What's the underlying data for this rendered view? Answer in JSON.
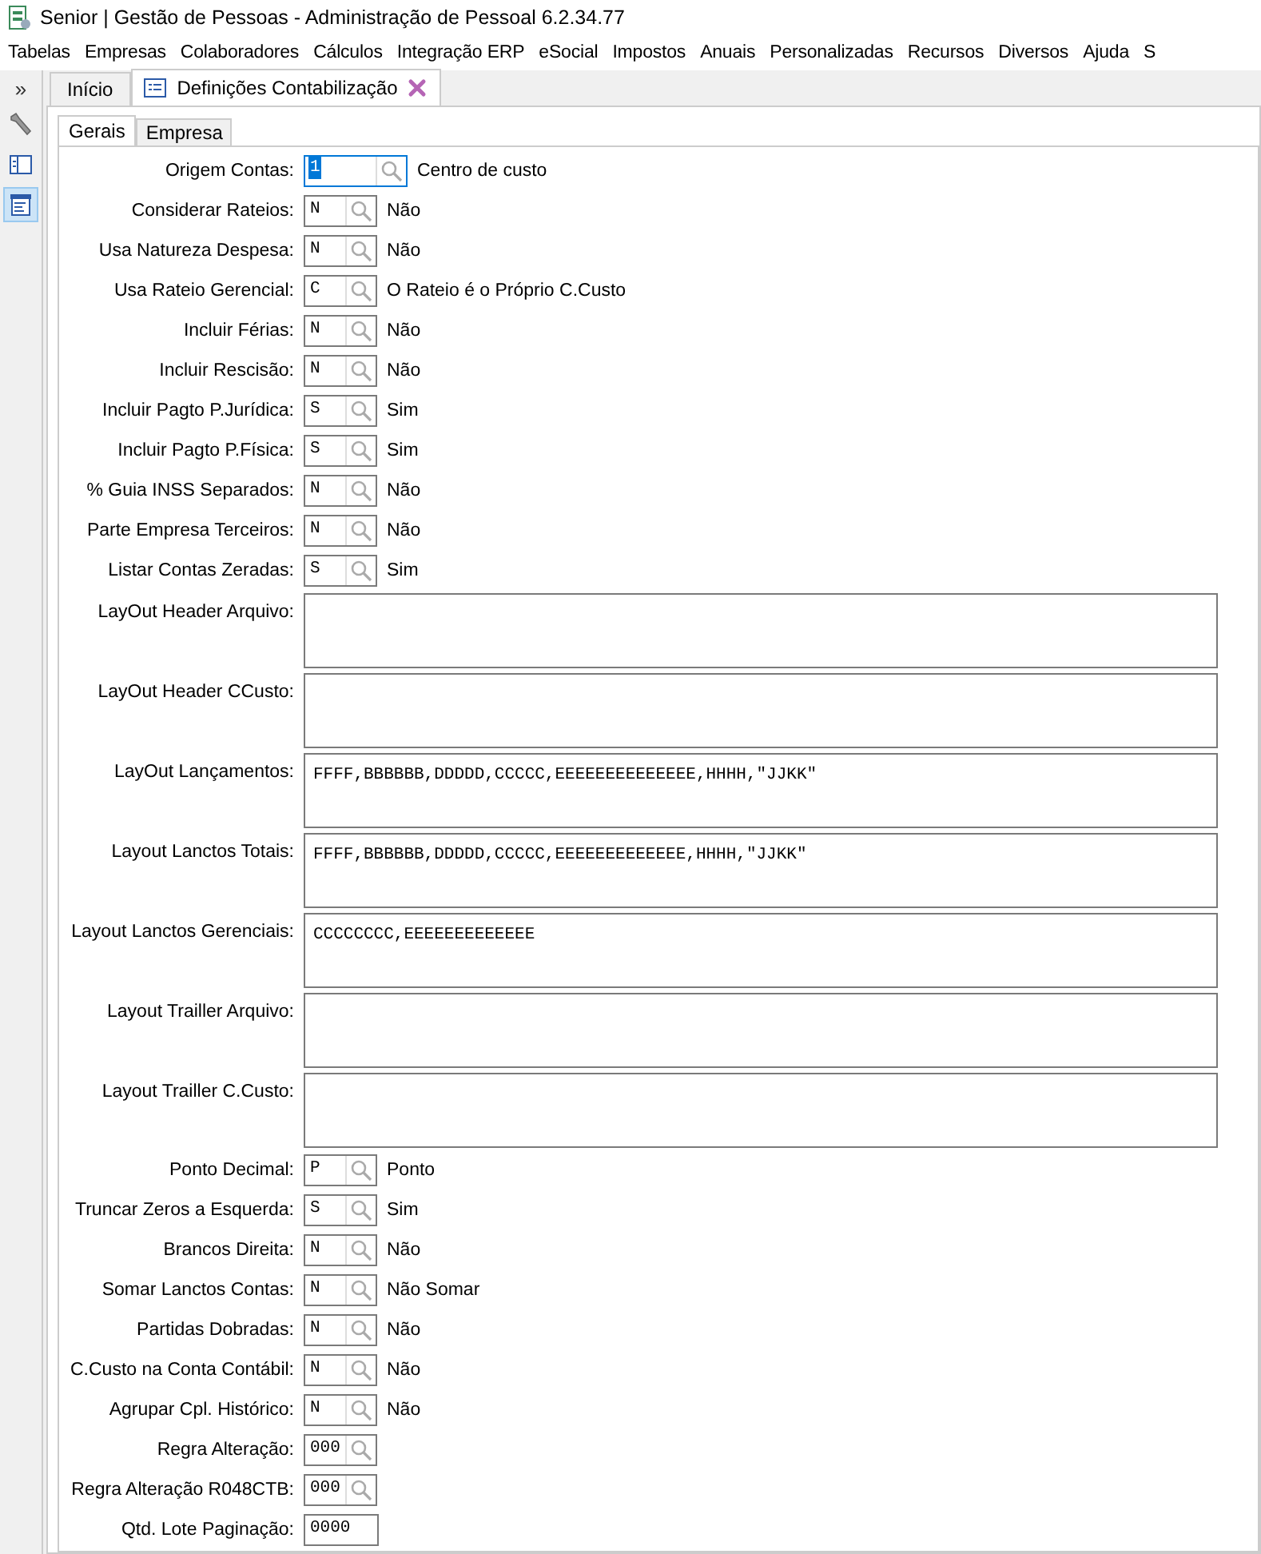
{
  "window": {
    "title": "Senior | Gestão de Pessoas - Administração de Pessoal 6.2.34.77"
  },
  "menu": [
    "Tabelas",
    "Empresas",
    "Colaboradores",
    "Cálculos",
    "Integração ERP",
    "eSocial",
    "Impostos",
    "Anuais",
    "Personalizadas",
    "Recursos",
    "Diversos",
    "Ajuda",
    "S"
  ],
  "sidebar": {
    "toggle": "»",
    "items": [
      {
        "selected": false
      },
      {
        "selected": false
      },
      {
        "selected": true
      }
    ]
  },
  "doc_tabs": [
    {
      "label": "Início",
      "selected": false,
      "closable": false
    },
    {
      "label": "Definições Contabilização",
      "selected": true,
      "closable": true
    }
  ],
  "form_tabs": [
    {
      "label": "Gerais",
      "selected": true
    },
    {
      "label": "Empresa",
      "selected": false
    }
  ],
  "fields": [
    {
      "kind": "lookup",
      "label": "Origem Contas:",
      "value": "1",
      "description": "Centro de custo",
      "focused": true
    },
    {
      "kind": "lookup",
      "label": "Considerar Rateios:",
      "value": "N",
      "description": "Não",
      "focused": false
    },
    {
      "kind": "lookup",
      "label": "Usa Natureza Despesa:",
      "value": "N",
      "description": "Não",
      "focused": false
    },
    {
      "kind": "lookup",
      "label": "Usa Rateio Gerencial:",
      "value": "C",
      "description": "O Rateio é o Próprio C.Custo",
      "focused": false
    },
    {
      "kind": "lookup",
      "label": "Incluir Férias:",
      "value": "N",
      "description": "Não",
      "focused": false
    },
    {
      "kind": "lookup",
      "label": "Incluir Rescisão:",
      "value": "N",
      "description": "Não",
      "focused": false
    },
    {
      "kind": "lookup",
      "label": "Incluir Pagto P.Jurídica:",
      "value": "S",
      "description": "Sim",
      "focused": false
    },
    {
      "kind": "lookup",
      "label": "Incluir Pagto P.Física:",
      "value": "S",
      "description": "Sim",
      "focused": false
    },
    {
      "kind": "lookup",
      "label": "% Guia INSS Separados:",
      "value": "N",
      "description": "Não",
      "focused": false
    },
    {
      "kind": "lookup",
      "label": "Parte Empresa Terceiros:",
      "value": "N",
      "description": "Não",
      "focused": false
    },
    {
      "kind": "lookup",
      "label": "Listar Contas Zeradas:",
      "value": "S",
      "description": "Sim",
      "focused": false
    },
    {
      "kind": "memo",
      "label": "LayOut Header Arquivo:"
    },
    {
      "kind": "memo",
      "label": "LayOut Header CCusto:"
    },
    {
      "kind": "memo",
      "label": "LayOut Lançamentos:",
      "value": "FFFF,BBBBBB,DDDDD,CCCCC,EEEEEEEEEEEEEE,HHHH,\"JJKK\""
    },
    {
      "kind": "memo",
      "label": "Layout Lanctos Totais:",
      "value": "FFFF,BBBBBB,DDDDD,CCCCC,EEEEEEEEEEEEE,HHHH,\"JJKK\""
    },
    {
      "kind": "memo",
      "label": "Layout Lanctos Gerenciais:",
      "value": "CCCCCCCC,EEEEEEEEEEEEE"
    },
    {
      "kind": "memo",
      "label": "Layout Trailler Arquivo:"
    },
    {
      "kind": "memo",
      "label": "Layout Trailler C.Custo:"
    },
    {
      "kind": "lookup",
      "label": "Ponto Decimal:",
      "value": "P",
      "description": "Ponto",
      "focused": false
    },
    {
      "kind": "lookup",
      "label": "Truncar Zeros a Esquerda:",
      "value": "S",
      "description": "Sim",
      "focused": false
    },
    {
      "kind": "lookup",
      "label": "Brancos Direita:",
      "value": "N",
      "description": "Não",
      "focused": false
    },
    {
      "kind": "lookup",
      "label": "Somar Lanctos Contas:",
      "value": "N",
      "description": "Não Somar",
      "focused": false
    },
    {
      "kind": "lookup",
      "label": "Partidas Dobradas:",
      "value": "N",
      "description": "Não",
      "focused": false
    },
    {
      "kind": "lookup",
      "label": "C.Custo na Conta Contábil:",
      "value": "N",
      "description": "Não",
      "focused": false
    },
    {
      "kind": "lookup",
      "label": "Agrupar Cpl. Histórico:",
      "value": "N",
      "description": "Não",
      "focused": false
    },
    {
      "kind": "lookup",
      "label": "Regra Alteração:",
      "value": "000",
      "focused": false
    },
    {
      "kind": "lookup",
      "label": "Regra Alteração R048CTB:",
      "value": "000",
      "focused": false
    },
    {
      "kind": "text",
      "label": "Qtd. Lote Paginação:",
      "value": "0000"
    }
  ]
}
